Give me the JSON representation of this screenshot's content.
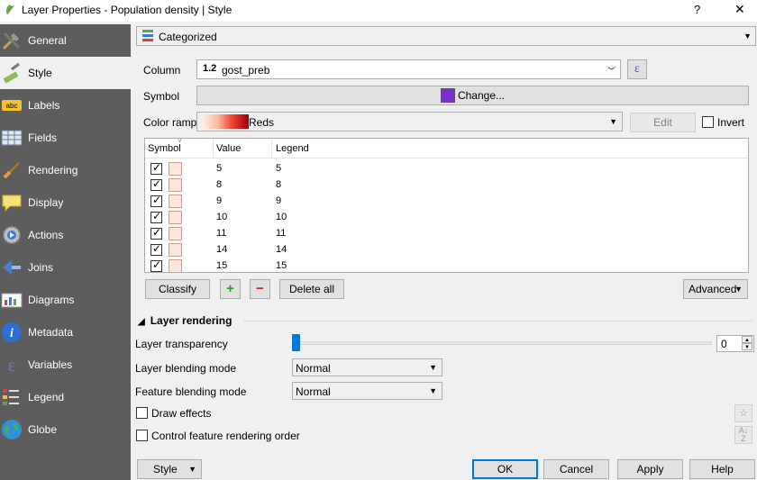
{
  "window": {
    "title": "Layer Properties - Population density | Style",
    "help_label": "?",
    "close_label": "✕"
  },
  "sidebar": {
    "items": [
      {
        "label": "General",
        "icon": "tools-icon"
      },
      {
        "label": "Style",
        "icon": "brush-icon"
      },
      {
        "label": "Labels",
        "icon": "abc-icon"
      },
      {
        "label": "Fields",
        "icon": "table-icon"
      },
      {
        "label": "Rendering",
        "icon": "paintbrush-icon"
      },
      {
        "label": "Display",
        "icon": "speech-bubble-icon"
      },
      {
        "label": "Actions",
        "icon": "gear-play-icon"
      },
      {
        "label": "Joins",
        "icon": "join-icon"
      },
      {
        "label": "Diagrams",
        "icon": "chart-icon"
      },
      {
        "label": "Metadata",
        "icon": "info-icon"
      },
      {
        "label": "Variables",
        "icon": "epsilon-icon"
      },
      {
        "label": "Legend",
        "icon": "legend-icon"
      },
      {
        "label": "Globe",
        "icon": "globe-icon"
      }
    ],
    "active_index": 1
  },
  "style": {
    "renderer": "Categorized",
    "column_label": "Column",
    "column_type": "1.2",
    "column_value": "gost_preb",
    "expression_glyph": "ε",
    "symbol_label": "Symbol",
    "symbol_button": "Change...",
    "symbol_color": "#7b2fd0",
    "color_ramp_label": "Color ramp",
    "color_ramp_value": "Reds",
    "edit_button": "Edit",
    "invert_label": "Invert",
    "table": {
      "headers": [
        "Symbol",
        "Value",
        "Legend"
      ],
      "rows": [
        {
          "value": "5",
          "legend": "5"
        },
        {
          "value": "8",
          "legend": "8"
        },
        {
          "value": "9",
          "legend": "9"
        },
        {
          "value": "10",
          "legend": "10"
        },
        {
          "value": "11",
          "legend": "11"
        },
        {
          "value": "14",
          "legend": "14"
        },
        {
          "value": "15",
          "legend": "15"
        }
      ],
      "swatch_color": "#fde5dc"
    },
    "classify_button": "Classify",
    "add_button": "+",
    "remove_button": "−",
    "delete_all_button": "Delete all",
    "advanced_button": "Advanced"
  },
  "layer_rendering": {
    "section_title": "Layer rendering",
    "transparency_label": "Layer transparency",
    "transparency_value": "0",
    "blending_label": "Layer blending mode",
    "blending_value": "Normal",
    "feature_blending_label": "Feature blending mode",
    "feature_blending_value": "Normal",
    "draw_effects_label": "Draw effects",
    "control_order_label": "Control feature rendering order"
  },
  "footer": {
    "style_button": "Style",
    "ok_button": "OK",
    "cancel_button": "Cancel",
    "apply_button": "Apply",
    "help_button": "Help"
  }
}
